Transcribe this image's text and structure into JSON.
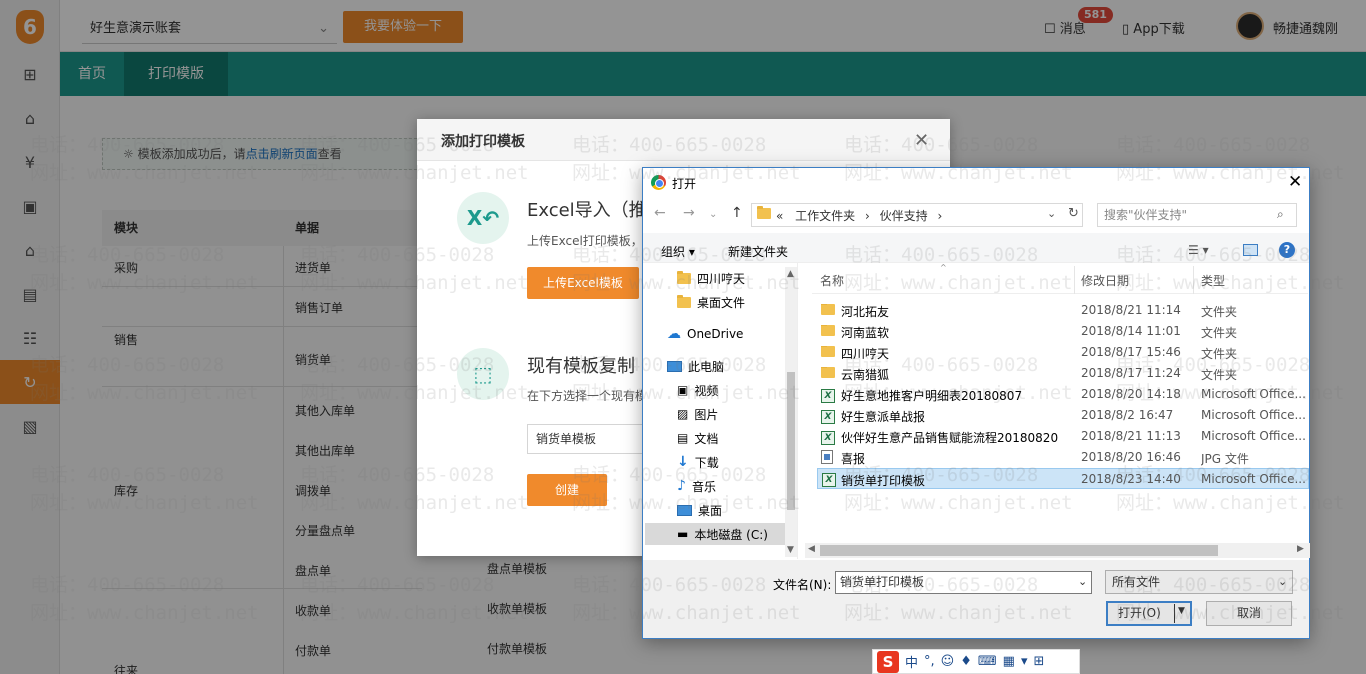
{
  "app": {
    "account_name": "好生意演示账套",
    "try_button": "我要体验一下",
    "messages_label": "消息",
    "messages_count": "581",
    "app_download": "App下载",
    "user_name": "畅捷通魏刚"
  },
  "nav": {
    "tabs": [
      "首页",
      "打印模版"
    ]
  },
  "tip": {
    "before": "模板添加成功后，请",
    "link": "点击刷新页面",
    "after": "查看"
  },
  "table": {
    "headers": [
      "模块",
      "单据"
    ],
    "module_labels": [
      "采购",
      "销售",
      "库存",
      "往来"
    ],
    "docs": [
      "进货单",
      "销售订单",
      "销货单",
      "其他入库单",
      "其他出库单",
      "调拨单",
      "分量盘点单",
      "盘点单",
      "收款单",
      "付款单"
    ],
    "extra_templates": [
      "盘点单模板",
      "收款单模板",
      "付款单模板"
    ]
  },
  "modal": {
    "title": "添加打印模板",
    "excel_heading": "Excel导入（推",
    "excel_desc": "上传Excel打印模板，",
    "upload_button": "上传Excel模板",
    "copy_heading": "现有模板复制",
    "copy_desc": "在下方选择一个现有模",
    "select_value": "销货单模板",
    "create_button": "创建"
  },
  "file_dialog": {
    "title": "打开",
    "breadcrumb": [
      "«",
      "工作文件夹",
      "›",
      "伙伴支持",
      "›"
    ],
    "search_placeholder": "搜索\"伙伴支持\"",
    "organize": "组织 ▾",
    "new_folder": "新建文件夹",
    "tree": [
      {
        "label": "四川哼天",
        "icon": "folder-icon"
      },
      {
        "label": "桌面文件",
        "icon": "folder-icon"
      },
      {
        "label": "OneDrive",
        "icon": "cloud-icon"
      },
      {
        "label": "此电脑",
        "icon": "computer-icon"
      },
      {
        "label": "视频",
        "icon": "video-icon"
      },
      {
        "label": "图片",
        "icon": "picture-icon"
      },
      {
        "label": "文档",
        "icon": "document-icon"
      },
      {
        "label": "下载",
        "icon": "download-icon"
      },
      {
        "label": "音乐",
        "icon": "music-icon"
      },
      {
        "label": "桌面",
        "icon": "desktop-icon"
      },
      {
        "label": "本地磁盘 (C:)",
        "icon": "drive-icon"
      }
    ],
    "columns": [
      "名称",
      "修改日期",
      "类型"
    ],
    "files": [
      {
        "name": "河北拓友",
        "date": "2018/8/21 11:14",
        "type": "文件夹",
        "icon": "folder"
      },
      {
        "name": "河南蓝软",
        "date": "2018/8/14 11:01",
        "type": "文件夹",
        "icon": "folder"
      },
      {
        "name": "四川哼天",
        "date": "2018/8/17 15:46",
        "type": "文件夹",
        "icon": "folder"
      },
      {
        "name": "云南猎狐",
        "date": "2018/8/17 11:24",
        "type": "文件夹",
        "icon": "folder"
      },
      {
        "name": "好生意地推客户明细表20180807",
        "date": "2018/8/20 14:18",
        "type": "Microsoft Office...",
        "icon": "excel"
      },
      {
        "name": "好生意派单战报",
        "date": "2018/8/2 16:47",
        "type": "Microsoft Office...",
        "icon": "excel"
      },
      {
        "name": "伙伴好生意产品销售赋能流程20180820",
        "date": "2018/8/21 11:13",
        "type": "Microsoft Office...",
        "icon": "excel"
      },
      {
        "name": "喜报",
        "date": "2018/8/20 16:46",
        "type": "JPG 文件",
        "icon": "jpg"
      },
      {
        "name": "销货单打印模板",
        "date": "2018/8/23 14:40",
        "type": "Microsoft Office...",
        "icon": "excel",
        "selected": true
      }
    ],
    "filename_label": "文件名(N):",
    "filename_value": "销货单打印模板",
    "filter_value": "所有文件",
    "open_button": "打开(O)",
    "cancel_button": "取消"
  },
  "ime": {
    "logo": "S",
    "mode": "中"
  },
  "watermark": {
    "phone": "电话：400-665-0028",
    "site": "网址：www.chanjet.net"
  }
}
